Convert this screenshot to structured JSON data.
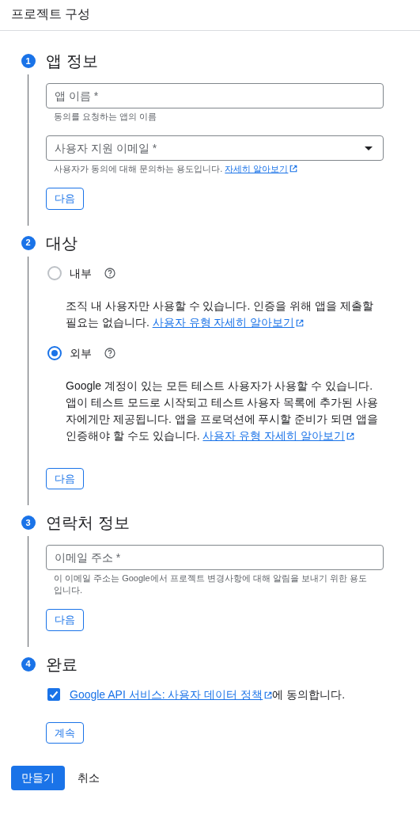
{
  "header": {
    "title": "프로젝트 구성"
  },
  "steps": [
    {
      "number": "1",
      "title": "앱 정보",
      "button": "다음",
      "items": [
        {
          "kind": "field",
          "placeholder": "앱 이름 *",
          "hint": "동의를 요청하는 앱의 이름"
        },
        {
          "kind": "select",
          "placeholder": "사용자 지원 이메일 *",
          "hint": "사용자가 동의에 대해 문의하는 용도입니다.",
          "link": "자세히 알아보기"
        }
      ]
    },
    {
      "number": "2",
      "title": "대상",
      "button": "다음",
      "items": [
        {
          "kind": "radio",
          "label": "내부",
          "selected": false,
          "description": "조직 내 사용자만 사용할 수 있습니다. 인증을 위해 앱을 제출할 필요는 없습니다.",
          "link": "사용자 유형 자세히 알아보기"
        },
        {
          "kind": "radio",
          "label": "외부",
          "selected": true,
          "description": "Google 계정이 있는 모든 테스트 사용자가 사용할 수 있습니다. 앱이 테스트 모드로 시작되고 테스트 사용자 목록에 추가된 사용자에게만 제공됩니다. 앱을 프로덕션에 푸시할 준비가 되면 앱을 인증해야 할 수도 있습니다.",
          "link": "사용자 유형 자세히 알아보기"
        }
      ]
    },
    {
      "number": "3",
      "title": "연락처 정보",
      "button": "다음",
      "items": [
        {
          "kind": "field",
          "placeholder": "이메일 주소 *",
          "hint": "이 이메일 주소는 Google에서 프로젝트 변경사항에 대해 알림을 보내기 위한 용도입니다."
        }
      ]
    },
    {
      "number": "4",
      "title": "완료",
      "button": "계속",
      "items": [
        {
          "kind": "checkbox",
          "checked": true,
          "link": "Google API 서비스: 사용자 데이터 정책",
          "text": "에 동의합니다."
        }
      ]
    }
  ],
  "footer": {
    "primary": "만들기",
    "secondary": "취소"
  }
}
